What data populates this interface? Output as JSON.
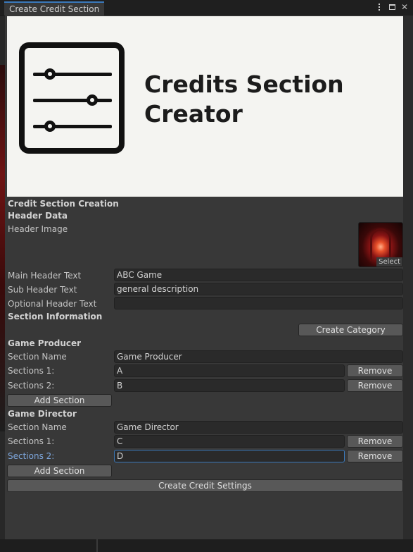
{
  "window": {
    "title": "Create Credit Section",
    "icons": [
      "more-menu-icon",
      "maximize-icon",
      "close-icon"
    ]
  },
  "banner": {
    "title_line1": "Credits Section",
    "title_line2": "Creator",
    "logo": "sliders-logo"
  },
  "form": {
    "main_heading": "Credit Section Creation",
    "header_data_heading": "Header Data",
    "header_image_label": "Header Image",
    "header_image_select": "Select",
    "main_header_label": "Main Header Text",
    "main_header_value": "ABC Game",
    "sub_header_label": "Sub Header Text",
    "sub_header_value": "general description",
    "optional_header_label": "Optional Header Text",
    "optional_header_value": "",
    "section_info_heading": "Section Information",
    "create_category_label": "Create Category",
    "create_credit_settings_label": "Create Credit Settings"
  },
  "categories": [
    {
      "title": "Game Producer",
      "section_name_label": "Section Name",
      "section_name_value": "Game Producer",
      "sections": [
        {
          "label": "Sections 1:",
          "value": "A",
          "remove": "Remove"
        },
        {
          "label": "Sections 2:",
          "value": "B",
          "remove": "Remove"
        }
      ],
      "add_section_label": "Add Section"
    },
    {
      "title": "Game Director",
      "section_name_label": "Section Name",
      "section_name_value": "Game Director",
      "sections": [
        {
          "label": "Sections 1:",
          "value": "C",
          "remove": "Remove"
        },
        {
          "label": "Sections 2:",
          "value": "D",
          "remove": "Remove"
        }
      ],
      "add_section_label": "Add Section"
    }
  ],
  "colors": {
    "panel": "#383838",
    "field": "#2a2a2a",
    "button": "#585858",
    "focus_accent": "#3a79bb",
    "active_label": "#7ea7dd"
  }
}
